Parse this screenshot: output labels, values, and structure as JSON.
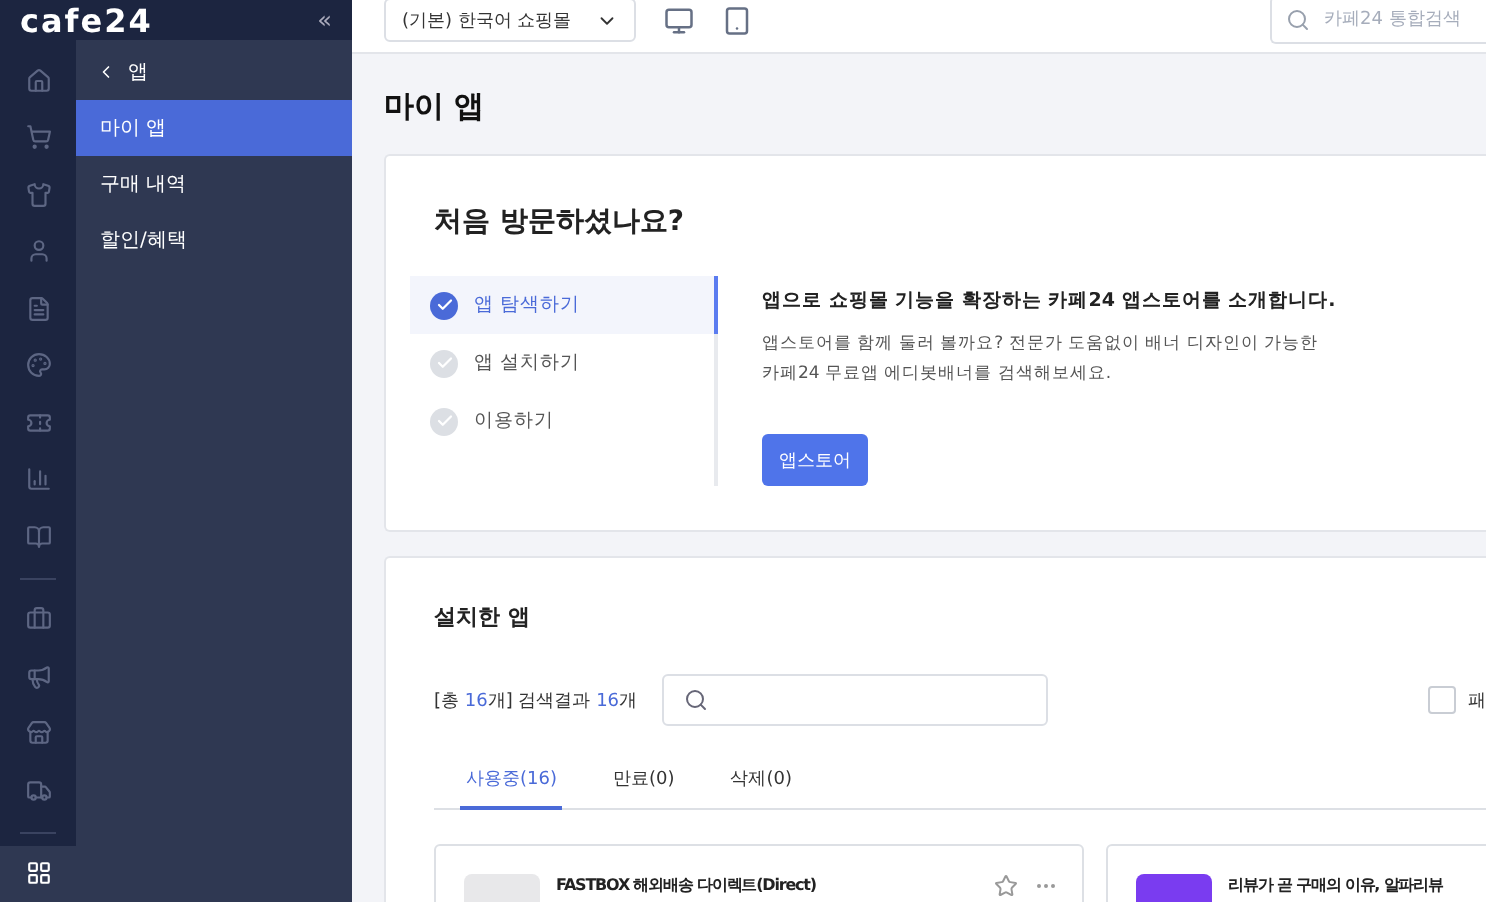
{
  "brand": {
    "logo": "cafe24",
    "collapse": "«"
  },
  "rail": [
    {
      "selected": false
    },
    {
      "selected": false
    },
    {
      "selected": false
    },
    {
      "selected": false
    },
    {
      "selected": false
    },
    {
      "selected": false
    },
    {
      "selected": false
    },
    {
      "selected": false
    },
    {
      "selected": false
    },
    {
      "selected": false
    },
    {
      "selected": false
    },
    {
      "selected": false
    },
    {
      "selected": false
    },
    {
      "selected": true
    }
  ],
  "submenu": {
    "back": "앱",
    "items": [
      {
        "label": "마이 앱",
        "selected": true
      },
      {
        "label": "구매 내역",
        "selected": false
      },
      {
        "label": "할인/혜택",
        "selected": false
      }
    ]
  },
  "topbar": {
    "shop_select": "(기본) 한국어 쇼핑몰",
    "search": {
      "placeholder": "카페24 통합검색"
    }
  },
  "page_title": "마이 앱",
  "welcome": {
    "title": "처음 방문하셨나요?",
    "steps": [
      {
        "label": "앱 탐색하기",
        "selected": true
      },
      {
        "label": "앱 설치하기",
        "selected": false
      },
      {
        "label": "이용하기",
        "selected": false
      }
    ],
    "heading": "앱으로 쇼핑몰 기능을 확장하는 카페24 앱스토어를 소개합니다.",
    "body": [
      "앱스토어를 함께 둘러 볼까요? 전문가 도움없이 배너 디자인이 가능한",
      "카페24 무료앱 에디봇배너를 검색해보세요."
    ],
    "button": "앱스토어"
  },
  "installed": {
    "title": "설치한 앱",
    "summary": {
      "prefix": "[총 ",
      "total": "16",
      "middle": "개] 검색결과 ",
      "found": "16",
      "suffix": "개"
    },
    "checkbox": {
      "label": "패",
      "checked": false
    },
    "tabs": [
      {
        "label": "사용중(16)",
        "selected": true
      },
      {
        "label": "만료(0)",
        "selected": false
      },
      {
        "label": "삭제(0)",
        "selected": false
      }
    ],
    "apps": [
      {
        "kind": "plain",
        "name": "FASTBOX 해외배송 다이렉트(Direct)"
      },
      {
        "kind": "brand",
        "name": "리뷰가 곧 구매의 이유, 알파리뷰"
      }
    ]
  }
}
